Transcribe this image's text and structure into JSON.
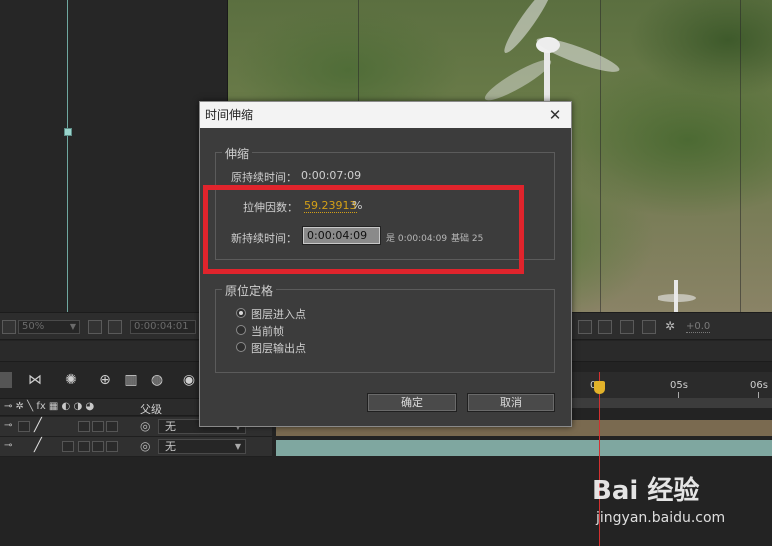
{
  "comp_toolbar": {
    "zoom": "50%",
    "timecode": "0:00:04:01",
    "exposure": "+0.0"
  },
  "timeline": {
    "parent_header": "父级",
    "layers": [
      {
        "parent": "无"
      },
      {
        "parent": "无"
      }
    ],
    "ruler_labels": [
      "0s",
      "05s",
      "06s"
    ]
  },
  "dialog": {
    "title": "时间伸缩",
    "stretch_group": {
      "title": "伸缩",
      "orig_label": "原持续时间：",
      "orig_value": "0:00:07:09",
      "factor_label": "拉伸因数：",
      "factor_value": "59.23913",
      "factor_unit": "%",
      "new_label": "新持续时间：",
      "new_value": "0:00:04:09",
      "is_label": "是 0:00:04:09",
      "base_label": "基础 25"
    },
    "hold_group": {
      "title": "原位定格",
      "options": [
        "图层进入点",
        "当前帧",
        "图层输出点"
      ],
      "selected_index": 0
    },
    "ok": "确定",
    "cancel": "取消"
  },
  "colors": {
    "highlight": "#e0242c",
    "factor_value": "#d4a017",
    "playhead": "#d23030"
  },
  "watermark": {
    "logo": "Bai  经验",
    "sub": "jingyan.baidu.com"
  }
}
